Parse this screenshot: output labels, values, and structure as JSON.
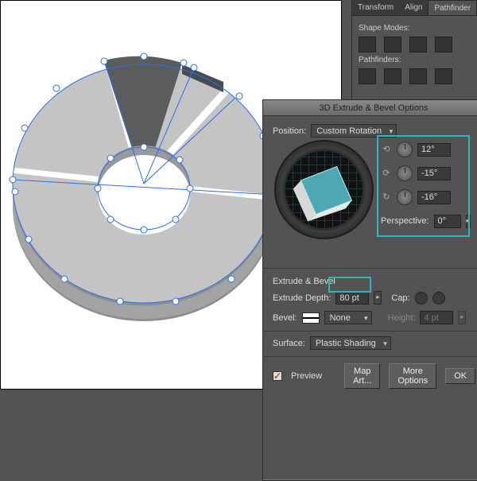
{
  "pathfinder": {
    "tabs": [
      "Transform",
      "Align",
      "Pathfinder"
    ],
    "shape_modes_label": "Shape Modes:",
    "pathfinders_label": "Pathfinders:"
  },
  "dialog": {
    "title": "3D Extrude & Bevel Options",
    "position_label": "Position:",
    "position_value": "Custom Rotation",
    "rotation_x": "12°",
    "rotation_y": "-15°",
    "rotation_z": "-16°",
    "perspective_label": "Perspective:",
    "perspective_value": "0°",
    "extrude_bevel_label": "Extrude & Bevel",
    "extrude_depth_label": "Extrude Depth:",
    "extrude_depth_value": "80 pt",
    "cap_label": "Cap:",
    "bevel_label": "Bevel:",
    "bevel_value": "None",
    "height_label": "Height:",
    "height_value": "4 pt",
    "surface_label": "Surface:",
    "surface_value": "Plastic Shading",
    "preview_label": "Preview",
    "map_art_label": "Map Art...",
    "more_options_label": "More Options",
    "ok_label": "OK"
  },
  "icons": {
    "rot_x": "⟲",
    "rot_y": "⟳",
    "rot_z": "↻",
    "step": "▸"
  },
  "chart_data": {
    "type": "pie",
    "title": "",
    "note": "Donut/pie artwork being extruded in Illustrator; four wedge shapes selected on canvas. No numeric axis data is present in the image.",
    "slices": [
      {
        "name": "dark-wedge",
        "approx_fraction": 0.12,
        "fill": "#5b5c5d"
      },
      {
        "name": "light-wedge-right",
        "approx_fraction": 0.3,
        "fill": "#c4c4c4"
      },
      {
        "name": "light-wedge-bottom",
        "approx_fraction": 0.3,
        "fill": "#c4c4c4"
      },
      {
        "name": "light-wedge-left",
        "approx_fraction": 0.28,
        "fill": "#c4c4c4"
      }
    ],
    "inner_radius_ratio": 0.35
  }
}
